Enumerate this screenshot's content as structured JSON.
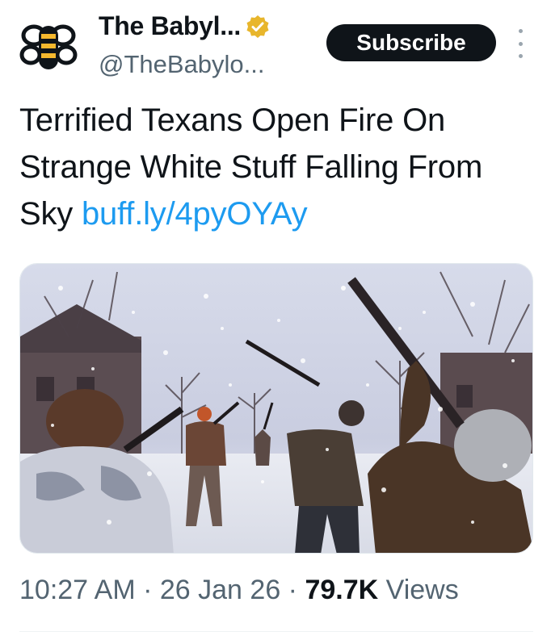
{
  "author": {
    "name": "The Babyl...",
    "handle": "@TheBabylo...",
    "verified_badge": "verified-gold-badge-icon",
    "avatar": "bee-logo-avatar"
  },
  "actions": {
    "subscribe_label": "Subscribe",
    "more_icon": "more-vertical-icon"
  },
  "tweet": {
    "text": "Terrified Texans Open Fire On Strange White Stuff Falling From Sky ",
    "link": "buff.ly/4pyOYAy"
  },
  "media": {
    "description_icon": "photo-media"
  },
  "meta": {
    "time": "10:27 AM",
    "sep1": " · ",
    "date": "26 Jan 26",
    "sep2": " · ",
    "views_count": "79.7K",
    "views_label": " Views"
  },
  "colors": {
    "link": "#1d9bf0",
    "text": "#0f1419",
    "secondary": "#536471",
    "button_bg": "#0f1419",
    "badge_gold": "#e8b62c"
  }
}
